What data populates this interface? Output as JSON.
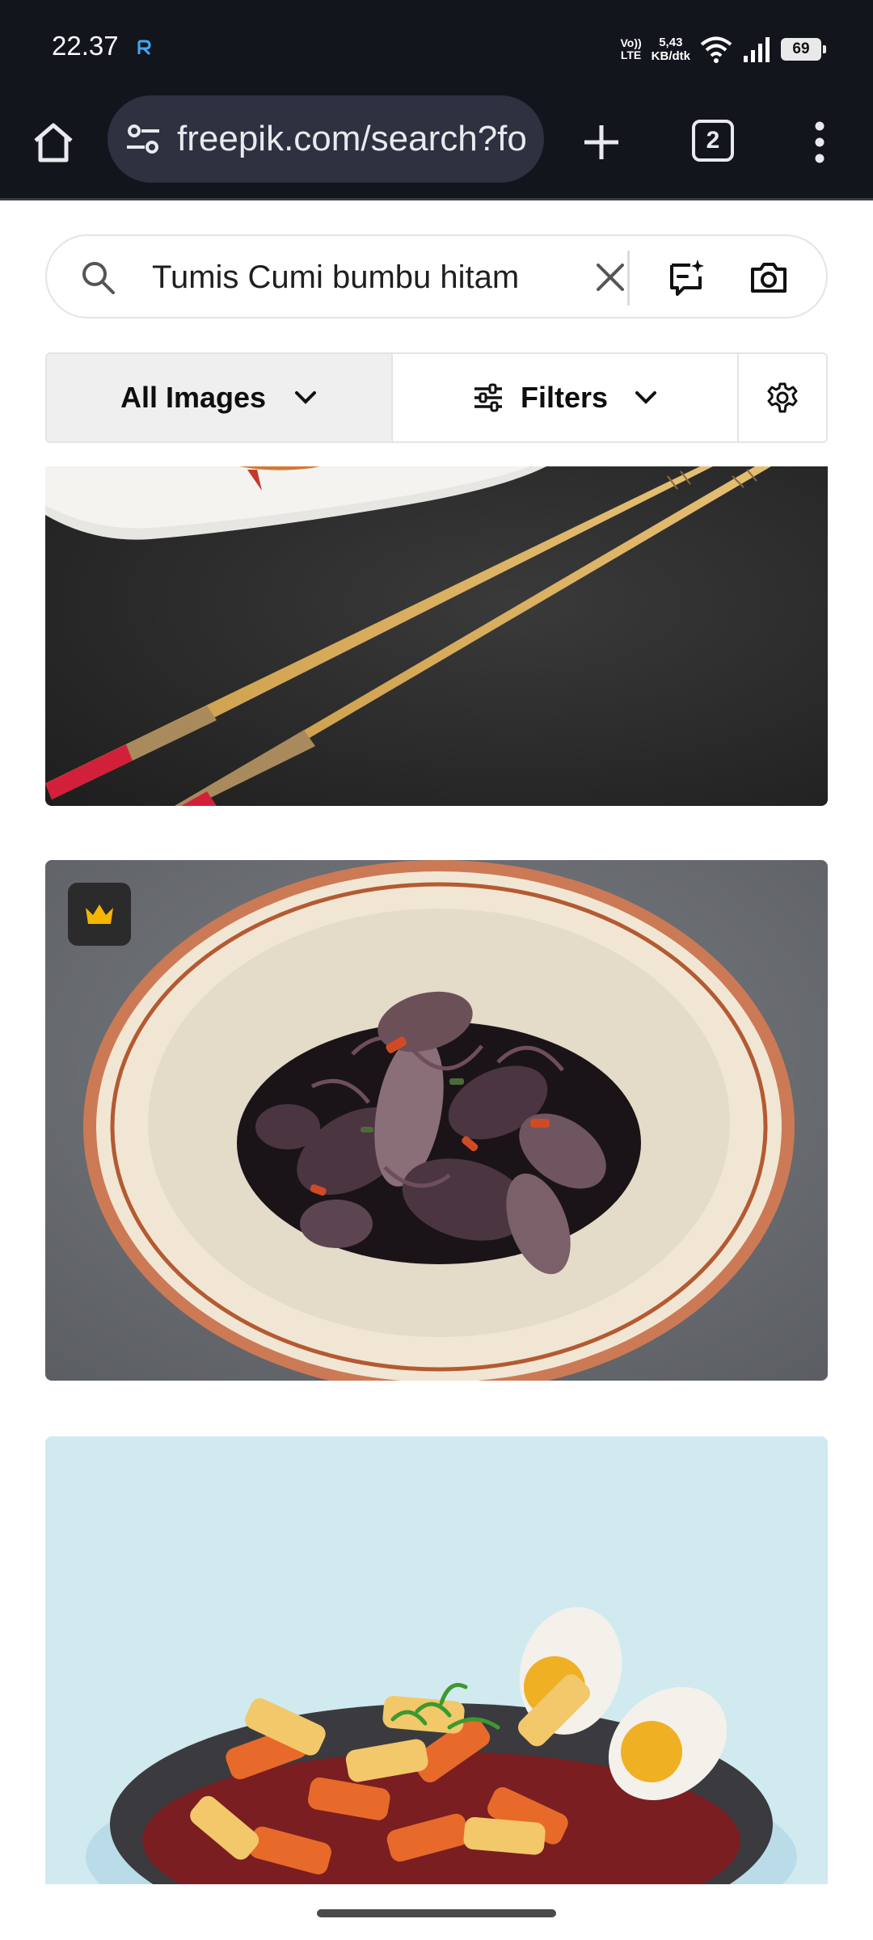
{
  "status_bar": {
    "time": "22.37",
    "volte_line1": "Vo))",
    "volte_line2": "LTE",
    "net_speed_value": "5,43",
    "net_speed_unit": "KB/dtk",
    "battery": "69"
  },
  "browser": {
    "url": "freepik.com/search?fo",
    "tab_count": "2"
  },
  "search": {
    "query": "Tumis Cumi bumbu hitam"
  },
  "filters": {
    "all_images_label": "All Images",
    "filters_label": "Filters"
  },
  "results": [
    {
      "kind": "photo",
      "subject": "chopsticks-on-dark-table",
      "premium": false
    },
    {
      "kind": "photo",
      "subject": "squid-in-black-sauce-plate",
      "premium": true
    },
    {
      "kind": "illustration",
      "subject": "tteokbokki-with-eggs",
      "premium": false
    }
  ],
  "colors": {
    "system_bar": "#12151c",
    "url_pill": "#2d3140",
    "filter_active": "#efefef",
    "premium_crown": "#f7b500"
  }
}
